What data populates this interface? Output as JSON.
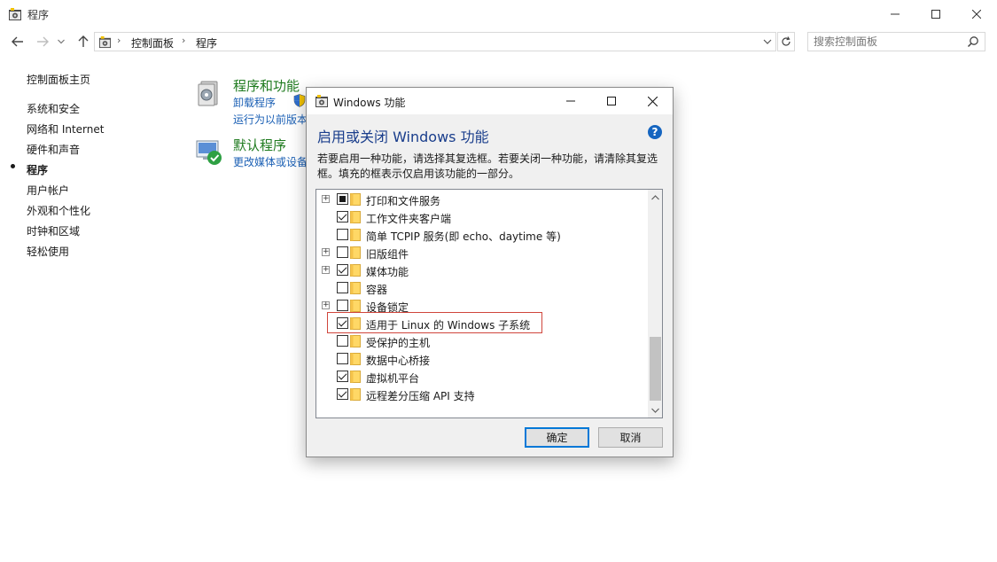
{
  "window": {
    "title": "程序"
  },
  "address": {
    "crumbs": [
      "控制面板",
      "程序"
    ],
    "search_placeholder": "搜索控制面板"
  },
  "sidebar": {
    "items": [
      {
        "label": "控制面板主页"
      },
      {
        "label": "系统和安全"
      },
      {
        "label": "网络和 Internet"
      },
      {
        "label": "硬件和声音"
      },
      {
        "label": "程序",
        "active": true
      },
      {
        "label": "用户帐户"
      },
      {
        "label": "外观和个性化"
      },
      {
        "label": "时钟和区域"
      },
      {
        "label": "轻松使用"
      }
    ]
  },
  "main": {
    "programs": {
      "title": "程序和功能",
      "links": [
        "卸载程序",
        "运行为以前版本"
      ]
    },
    "defaults": {
      "title": "默认程序",
      "links": [
        "更改媒体或设备"
      ]
    }
  },
  "dialog": {
    "title": "Windows 功能",
    "heading": "启用或关闭 Windows 功能",
    "description": "若要启用一种功能，请选择其复选框。若要关闭一种功能，请清除其复选框。填充的框表示仅启用该功能的一部分。",
    "features": [
      {
        "label": "打印和文件服务",
        "state": "partial",
        "expandable": true
      },
      {
        "label": "工作文件夹客户端",
        "state": "checked",
        "expandable": false
      },
      {
        "label": "简单 TCPIP 服务(即 echo、daytime 等)",
        "state": "unchecked",
        "expandable": false
      },
      {
        "label": "旧版组件",
        "state": "unchecked",
        "expandable": true
      },
      {
        "label": "媒体功能",
        "state": "checked",
        "expandable": true
      },
      {
        "label": "容器",
        "state": "unchecked",
        "expandable": false
      },
      {
        "label": "设备锁定",
        "state": "unchecked",
        "expandable": true
      },
      {
        "label": "适用于 Linux 的 Windows 子系统",
        "state": "checked",
        "expandable": false,
        "highlighted": true
      },
      {
        "label": "受保护的主机",
        "state": "unchecked",
        "expandable": false
      },
      {
        "label": "数据中心桥接",
        "state": "unchecked",
        "expandable": false
      },
      {
        "label": "虚拟机平台",
        "state": "checked",
        "expandable": false
      },
      {
        "label": "远程差分压缩 API 支持",
        "state": "checked",
        "expandable": false
      }
    ],
    "ok_label": "确定",
    "cancel_label": "取消"
  },
  "colors": {
    "accent": "#0078d7",
    "section_title": "#1e7a1e",
    "link": "#1a5fb4",
    "dialog_heading": "#1a3e8c",
    "highlight_border": "#d0463c"
  }
}
